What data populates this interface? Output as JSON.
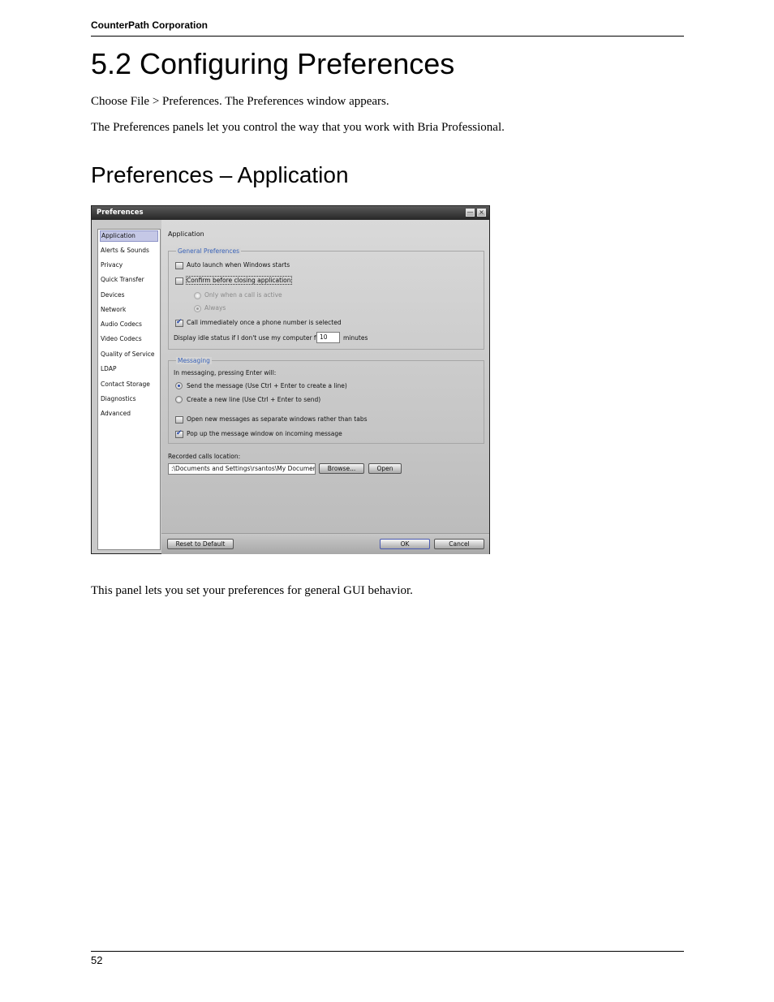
{
  "header": {
    "company": "CounterPath Corporation"
  },
  "page": {
    "title": "5.2 Configuring Preferences",
    "para1": "Choose File > Preferences. The Preferences window appears.",
    "para2": "The Preferences panels let you control the way that you work with Bria Professional.",
    "section_title": "Preferences – Application",
    "para3": "This panel lets you set your preferences for general GUI behavior.",
    "page_number": "52"
  },
  "window": {
    "title": "Preferences",
    "sidebar_items": [
      {
        "label": "Application",
        "selected": true
      },
      {
        "label": "Alerts & Sounds",
        "selected": false
      },
      {
        "label": "Privacy",
        "selected": false
      },
      {
        "label": "Quick Transfer",
        "selected": false
      },
      {
        "label": "Devices",
        "selected": false
      },
      {
        "label": "Network",
        "selected": false
      },
      {
        "label": "Audio Codecs",
        "selected": false
      },
      {
        "label": "Video Codecs",
        "selected": false
      },
      {
        "label": "Quality of Service",
        "selected": false
      },
      {
        "label": "LDAP",
        "selected": false
      },
      {
        "label": "Contact Storage",
        "selected": false
      },
      {
        "label": "Diagnostics",
        "selected": false
      },
      {
        "label": "Advanced",
        "selected": false
      }
    ],
    "panel_title": "Application",
    "general": {
      "title": "General Preferences",
      "auto_launch": {
        "label": "Auto launch when Windows starts",
        "checked": false
      },
      "confirm_close": {
        "label": "Confirm before closing application",
        "checked": false
      },
      "only_when_active": {
        "label": "Only when a call is active",
        "selected": false
      },
      "always": {
        "label": "Always",
        "selected": true
      },
      "call_immediately": {
        "label": "Call immediately once a phone number is selected",
        "checked": true
      },
      "idle_label": "Display idle status if I don't use my computer for:",
      "idle_value": "10",
      "idle_unit": "minutes"
    },
    "messaging": {
      "title": "Messaging",
      "intro": "In messaging, pressing Enter will:",
      "send_message": {
        "label": "Send the message (Use Ctrl + Enter to create a line)",
        "selected": true
      },
      "new_line": {
        "label": "Create a new line (Use Ctrl + Enter to send)",
        "selected": false
      },
      "separate_windows": {
        "label": "Open new messages as separate windows rather than tabs",
        "checked": false
      },
      "popup": {
        "label": "Pop up the message window on incoming message",
        "checked": true
      }
    },
    "recorded": {
      "label": "Recorded calls location:",
      "path": ":\\Documents and Settings\\rsantos\\My Documents",
      "browse_label": "Browse...",
      "open_label": "Open"
    },
    "reset_label": "Reset to Default",
    "ok_label": "OK",
    "cancel_label": "Cancel"
  }
}
